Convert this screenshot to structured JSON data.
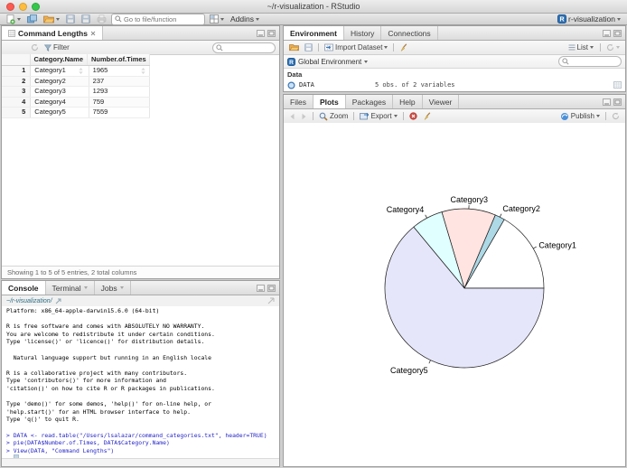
{
  "window": {
    "title": "~/r-visualization - RStudio",
    "project_button": "r-visualization"
  },
  "main_toolbar": {
    "goto_placeholder": "Go to file/function",
    "addins_label": "Addins"
  },
  "data_viewer": {
    "tab_title": "Command Lengths",
    "filter_button": "Filter",
    "columns": [
      "Category.Name",
      "Number.of.Times"
    ],
    "rows": [
      {
        "num": "1",
        "name": "Category1",
        "times": "1965"
      },
      {
        "num": "2",
        "name": "Category2",
        "times": "237"
      },
      {
        "num": "3",
        "name": "Category3",
        "times": "1293"
      },
      {
        "num": "4",
        "name": "Category4",
        "times": "759"
      },
      {
        "num": "5",
        "name": "Category5",
        "times": "7559"
      }
    ],
    "status": "Showing 1 to 5 of 5 entries, 2 total columns"
  },
  "console_panel": {
    "tabs": [
      "Console",
      "Terminal",
      "Jobs"
    ],
    "working_dir": "~/r-visualization/",
    "lines": [
      {
        "kind": "output",
        "text": "Platform: x86_64-apple-darwin15.6.0 (64-bit)"
      },
      {
        "kind": "output",
        "text": ""
      },
      {
        "kind": "output",
        "text": "R is free software and comes with ABSOLUTELY NO WARRANTY."
      },
      {
        "kind": "output",
        "text": "You are welcome to redistribute it under certain conditions."
      },
      {
        "kind": "output",
        "text": "Type 'license()' or 'licence()' for distribution details."
      },
      {
        "kind": "output",
        "text": ""
      },
      {
        "kind": "output",
        "text": "  Natural language support but running in an English locale"
      },
      {
        "kind": "output",
        "text": ""
      },
      {
        "kind": "output",
        "text": "R is a collaborative project with many contributors."
      },
      {
        "kind": "output",
        "text": "Type 'contributors()' for more information and"
      },
      {
        "kind": "output",
        "text": "'citation()' on how to cite R or R packages in publications."
      },
      {
        "kind": "output",
        "text": ""
      },
      {
        "kind": "output",
        "text": "Type 'demo()' for some demos, 'help()' for on-line help, or"
      },
      {
        "kind": "output",
        "text": "'help.start()' for an HTML browser interface to help."
      },
      {
        "kind": "output",
        "text": "Type 'q()' to quit R."
      },
      {
        "kind": "output",
        "text": ""
      },
      {
        "kind": "input",
        "text": "> DATA <- read.table(\"/Users/lsalazar/command_categories.txt\", header=TRUE)"
      },
      {
        "kind": "input",
        "text": "> pie(DATA$Number.of.Times, DATA$Category.Name)"
      },
      {
        "kind": "input",
        "text": "> View(DATA, \"Command Lengths\")"
      },
      {
        "kind": "prompt",
        "text": "> "
      }
    ]
  },
  "environment_panel": {
    "tabs": [
      "Environment",
      "History",
      "Connections"
    ],
    "import_dataset_label": "Import Dataset",
    "list_label": "List",
    "scope_label": "Global Environment",
    "section_label": "Data",
    "objects": [
      {
        "name": "DATA",
        "summary": "5 obs. of 2 variables"
      }
    ]
  },
  "plots_panel": {
    "tabs": [
      "Files",
      "Plots",
      "Packages",
      "Help",
      "Viewer"
    ],
    "zoom_label": "Zoom",
    "export_label": "Export",
    "publish_label": "Publish"
  },
  "chart_data": {
    "type": "pie",
    "title": "",
    "categories": [
      "Category1",
      "Category2",
      "Category3",
      "Category4",
      "Category5"
    ],
    "values": [
      1965,
      237,
      1293,
      759,
      7559
    ],
    "colors": [
      "#FFFFFF",
      "#ADD8E6",
      "#FFE4E1",
      "#E0FFFF",
      "#E6E6FA"
    ],
    "edge_color": "#1A1A1A",
    "start_angle_deg": 0,
    "direction": "counterclockwise",
    "legend": "none"
  }
}
